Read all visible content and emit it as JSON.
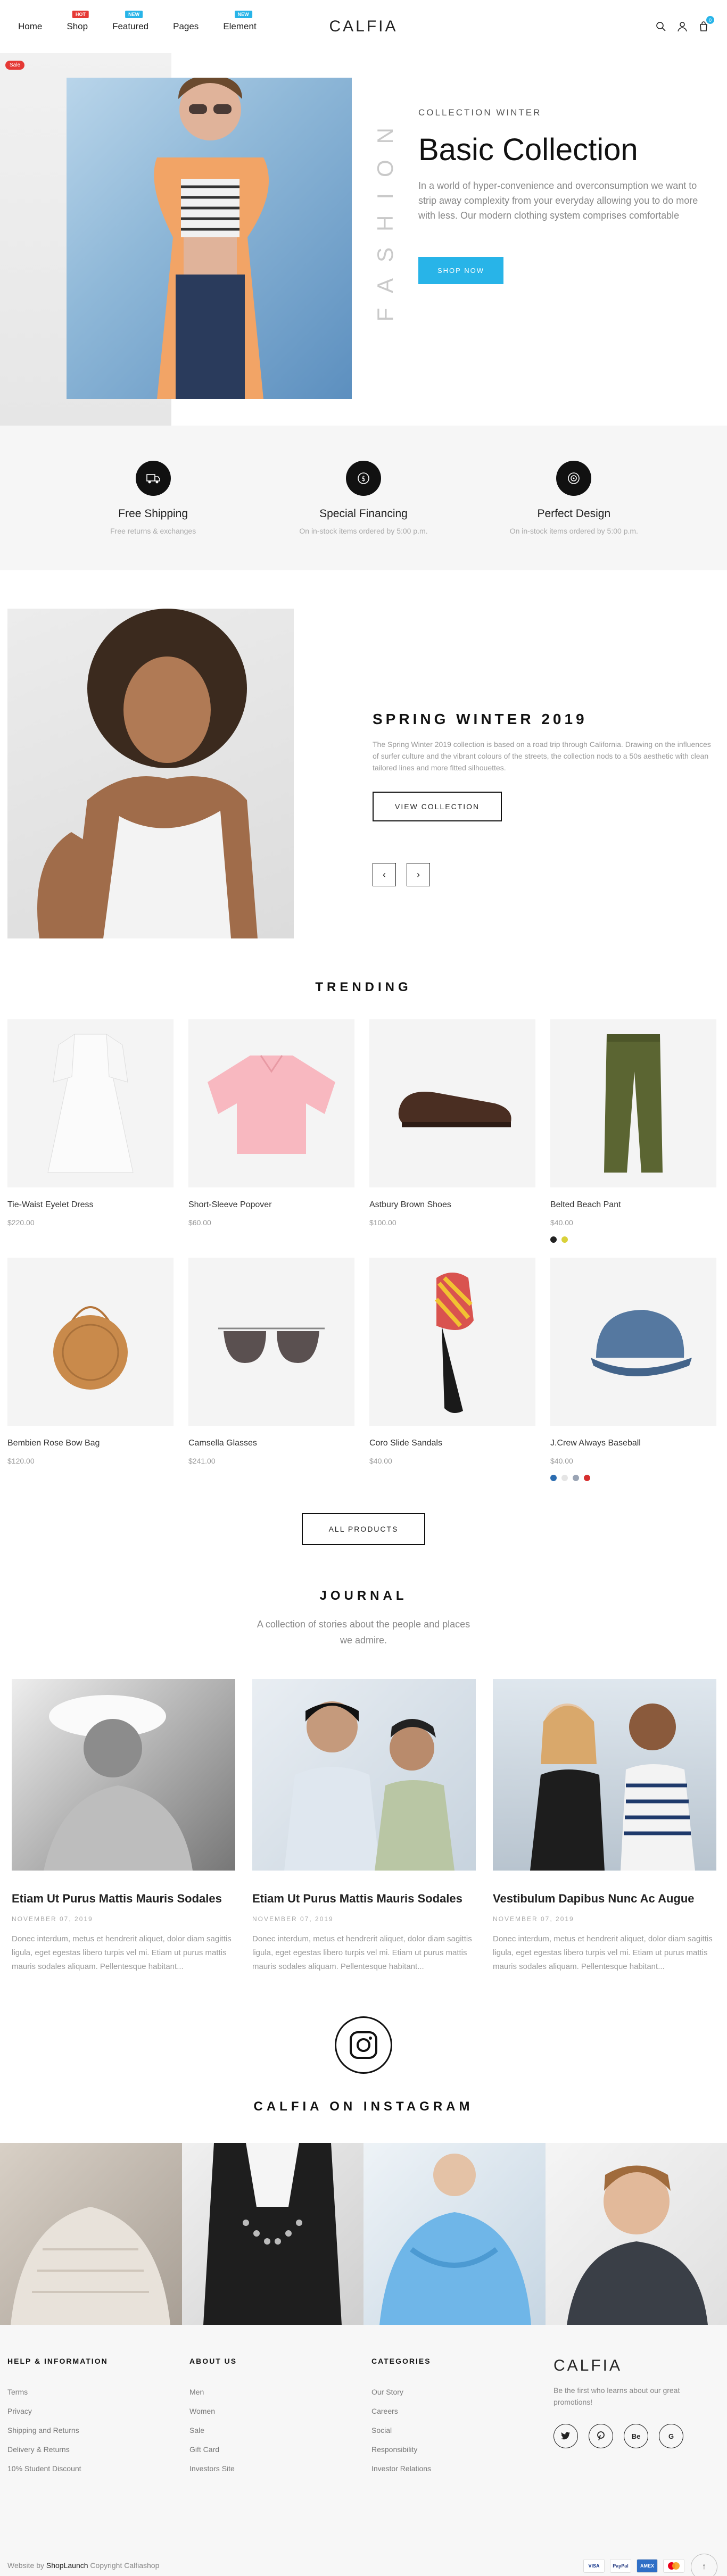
{
  "brand": "CALFIA",
  "nav": {
    "items": [
      {
        "label": "Home",
        "badge": ""
      },
      {
        "label": "Shop",
        "badge": "HOT"
      },
      {
        "label": "Featured",
        "badge": "NEW"
      },
      {
        "label": "Pages",
        "badge": ""
      },
      {
        "label": "Element",
        "badge": "NEW"
      }
    ],
    "cart_count": "0"
  },
  "hero": {
    "sale_badge": "Sale",
    "vertical_word": "FASHION",
    "kicker": "COLLECTION WINTER",
    "title": "Basic Collection",
    "description": "In a world of hyper-convenience and overconsumption we want to strip away complexity from your everyday allowing you to do more with less. Our modern clothing system comprises comfortable",
    "button": "SHOP NOW"
  },
  "features": [
    {
      "icon": "shipping-icon",
      "title": "Free Shipping",
      "subtitle": "Free returns & exchanges"
    },
    {
      "icon": "financing-icon",
      "title": "Special Financing",
      "subtitle": "On in-stock items ordered by 5:00 p.m."
    },
    {
      "icon": "design-icon",
      "title": "Perfect Design",
      "subtitle": "On in-stock items ordered by 5:00 p.m."
    }
  ],
  "spring": {
    "title": "SPRING WINTER 2019",
    "description": "The Spring Winter 2019 collection is based on a road trip through California. Drawing on the influences of surfer culture and the vibrant colours of the streets, the collection nods to a 50s aesthetic with clean tailored lines and more fitted silhouettes.",
    "button": "VIEW COLLECTION",
    "prev": "‹",
    "next": "›"
  },
  "trending": {
    "title": "TRENDING",
    "products": [
      {
        "name": "Tie-Waist Eyelet Dress",
        "price": "$220.00",
        "swatches": []
      },
      {
        "name": "Short-Sleeve Popover",
        "price": "$60.00",
        "swatches": []
      },
      {
        "name": "Astbury Brown Shoes",
        "price": "$100.00",
        "swatches": []
      },
      {
        "name": "Belted Beach Pant",
        "price": "$40.00",
        "swatches": [
          "#222222",
          "#d9d13a"
        ]
      },
      {
        "name": "Bembien Rose Bow Bag",
        "price": "$120.00",
        "swatches": []
      },
      {
        "name": "Camsella Glasses",
        "price": "$241.00",
        "swatches": []
      },
      {
        "name": "Coro Slide Sandals",
        "price": "$40.00",
        "swatches": []
      },
      {
        "name": "J.Crew Always Baseball",
        "price": "$40.00",
        "swatches": [
          "#2b6cb0",
          "#e5e5e5",
          "#9aa4b4",
          "#d62f2f"
        ]
      }
    ],
    "all_button": "ALL PRODUCTS"
  },
  "journal": {
    "title": "JOURNAL",
    "subtitle": "A collection of stories about the people and places we admire.",
    "posts": [
      {
        "title": "Etiam Ut Purus Mattis Mauris Sodales",
        "date": "NOVEMBER 07, 2019",
        "excerpt": "Donec interdum, metus et hendrerit aliquet, dolor diam sagittis ligula, eget egestas libero turpis vel mi. Etiam ut purus mattis mauris sodales aliquam. Pellentesque habitant..."
      },
      {
        "title": "Etiam Ut Purus Mattis Mauris Sodales",
        "date": "NOVEMBER 07, 2019",
        "excerpt": "Donec interdum, metus et hendrerit aliquet, dolor diam sagittis ligula, eget egestas libero turpis vel mi. Etiam ut purus mattis mauris sodales aliquam. Pellentesque habitant..."
      },
      {
        "title": "Vestibulum Dapibus Nunc Ac Augue",
        "date": "NOVEMBER 07, 2019",
        "excerpt": "Donec interdum, metus et hendrerit aliquet, dolor diam sagittis ligula, eget egestas libero turpis vel mi. Etiam ut purus mattis mauris sodales aliquam. Pellentesque habitant..."
      }
    ]
  },
  "instagram": {
    "title": "CALFIA ON INSTAGRAM"
  },
  "footer": {
    "columns": [
      {
        "heading": "HELP & INFORMATION",
        "links": [
          "Terms",
          "Privacy",
          "Shipping and Returns",
          "Delivery & Returns",
          "10% Student Discount"
        ]
      },
      {
        "heading": "ABOUT US",
        "links": [
          "Men",
          "Women",
          "Sale",
          "Gift Card",
          "Investors Site"
        ]
      },
      {
        "heading": "CATEGORIES",
        "links": [
          "Our Story",
          "Careers",
          "Social",
          "Responsibility",
          "Investor Relations"
        ]
      }
    ],
    "newsletter": "Be the first who learns about our great promotions!",
    "social": [
      "tw",
      "pin",
      "Be",
      "G"
    ],
    "copyright_prefix": "Website by",
    "copyright_brand": "ShopLaunch",
    "copyright_suffix": "Copyright Calfiashop",
    "payments": [
      "VISA",
      "PayPal",
      "AMEX",
      "MC"
    ]
  },
  "colors": {
    "accent": "#28b4e8",
    "hot": "#e53935"
  }
}
